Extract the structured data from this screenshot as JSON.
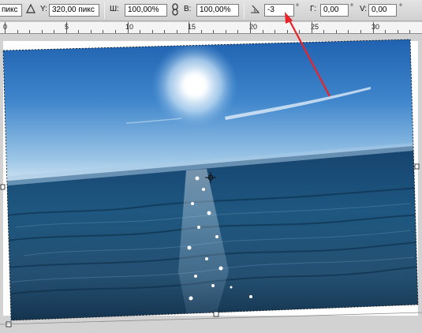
{
  "options_bar": {
    "x_value_tail": "пикс",
    "delta_icon": "delta-icon",
    "y_label": "Y:",
    "y_value": "320,00 пикс",
    "width_label": "Ш:",
    "width_value": "100,00%",
    "link_icon": "link-icon",
    "height_label": "В:",
    "height_value": "100,00%",
    "angle_icon": "angle-icon",
    "angle_value": "-3",
    "degree_symbol": "°",
    "h_skew_label": "Г:",
    "h_skew_value": "0,00",
    "v_skew_label": "V:",
    "v_skew_value": "0,00"
  },
  "ruler": {
    "labels": [
      "0",
      "5",
      "10",
      "15",
      "20",
      "25",
      "30"
    ]
  },
  "colors": {
    "annotation_arrow": "#e8232a"
  }
}
